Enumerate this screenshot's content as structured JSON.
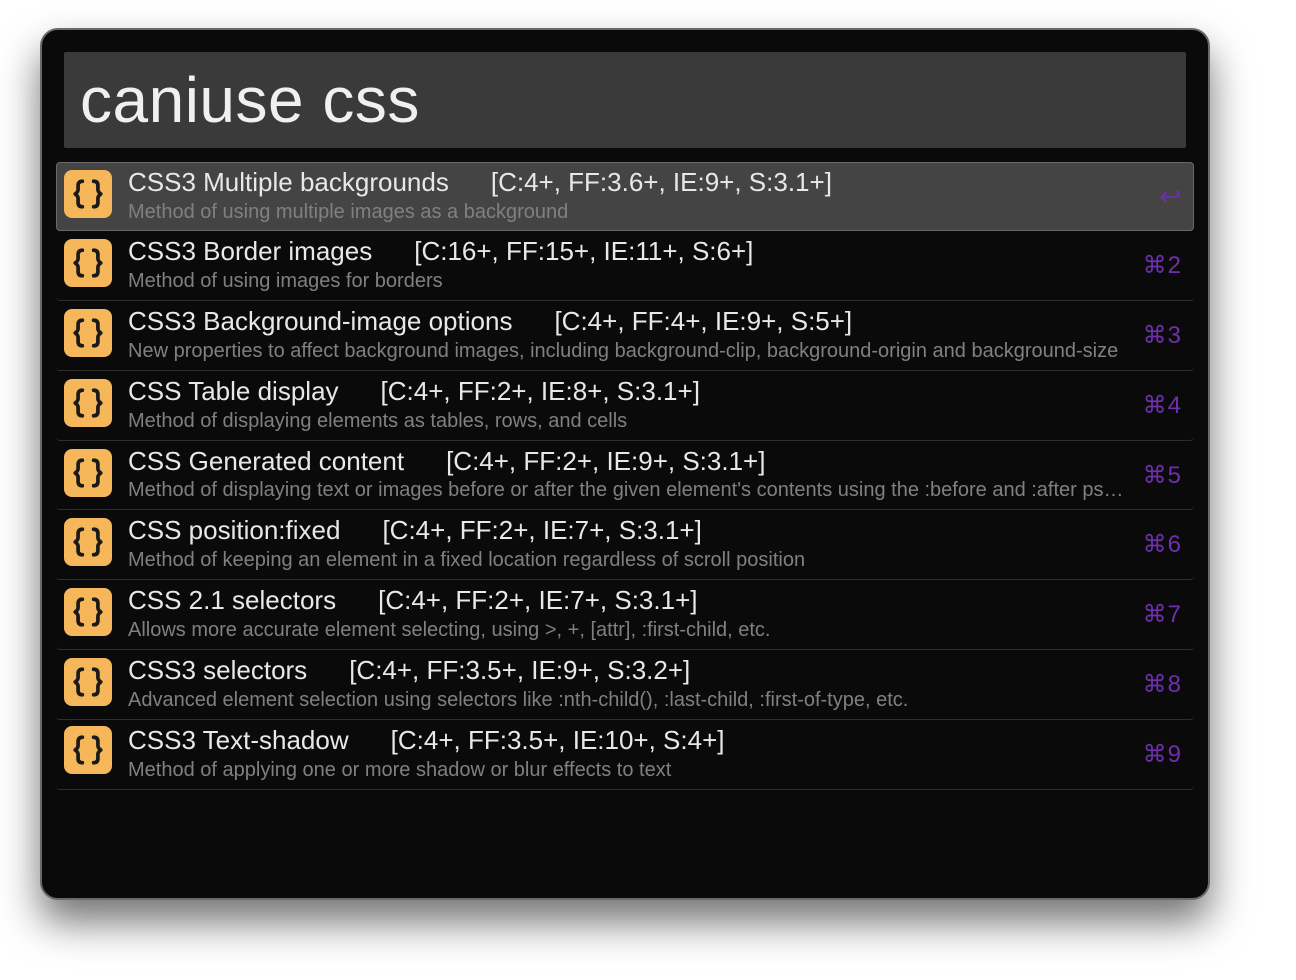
{
  "search": {
    "value": "caniuse css"
  },
  "colors": {
    "icon_bg": "#f6b65a",
    "shortcut": "#6f2fae",
    "selected_bg": "#444444"
  },
  "icon_name": "braces-icon",
  "results": [
    {
      "title": "CSS3 Multiple backgrounds",
      "compat": "[C:4+, FF:3.6+, IE:9+, S:3.1+]",
      "desc": "Method of using multiple images as a background",
      "shortcut": "↩",
      "selected": true
    },
    {
      "title": "CSS3 Border images",
      "compat": "[C:16+, FF:15+, IE:11+, S:6+]",
      "desc": "Method of using images for borders",
      "shortcut": "⌘2",
      "selected": false
    },
    {
      "title": "CSS3 Background-image options",
      "compat": "[C:4+, FF:4+, IE:9+, S:5+]",
      "desc": "New properties to affect background images, including background-clip, background-origin and background-size",
      "shortcut": "⌘3",
      "selected": false
    },
    {
      "title": "CSS Table display",
      "compat": "[C:4+, FF:2+, IE:8+, S:3.1+]",
      "desc": "Method of displaying elements as tables, rows, and cells",
      "shortcut": "⌘4",
      "selected": false
    },
    {
      "title": "CSS Generated content",
      "compat": "[C:4+, FF:2+, IE:9+, S:3.1+]",
      "desc": "Method of displaying text or images before or after the given element's contents using the :before and :after pseudo-elements",
      "shortcut": "⌘5",
      "selected": false
    },
    {
      "title": "CSS position:fixed",
      "compat": "[C:4+, FF:2+, IE:7+, S:3.1+]",
      "desc": "Method of keeping an element in a fixed location regardless of scroll position",
      "shortcut": "⌘6",
      "selected": false
    },
    {
      "title": "CSS 2.1 selectors",
      "compat": "[C:4+, FF:2+, IE:7+, S:3.1+]",
      "desc": "Allows more accurate element selecting, using >, +, [attr], :first-child, etc.",
      "shortcut": "⌘7",
      "selected": false
    },
    {
      "title": "CSS3 selectors",
      "compat": "[C:4+, FF:3.5+, IE:9+, S:3.2+]",
      "desc": "Advanced element selection using selectors like :nth-child(), :last-child, :first-of-type, etc.",
      "shortcut": "⌘8",
      "selected": false
    },
    {
      "title": "CSS3 Text-shadow",
      "compat": "[C:4+, FF:3.5+, IE:10+, S:4+]",
      "desc": "Method of applying one or more shadow or blur effects to text",
      "shortcut": "⌘9",
      "selected": false
    }
  ]
}
